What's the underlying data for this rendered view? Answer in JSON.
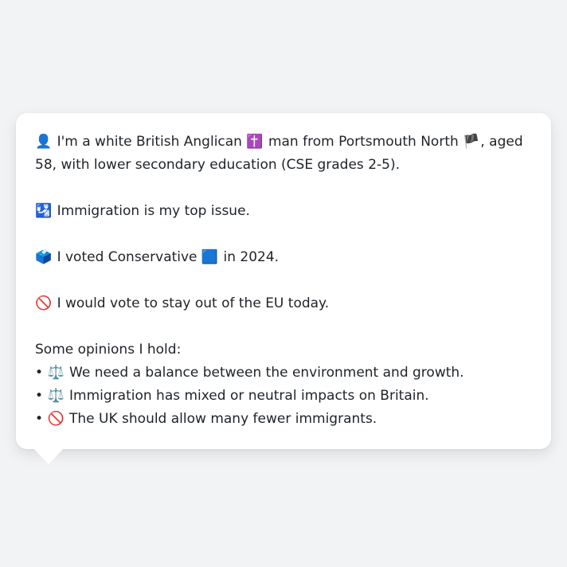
{
  "profile": {
    "identity": {
      "person_emoji": "👤",
      "text_before_religion": "I'm a white British Anglican",
      "religion_emoji": "✝️",
      "text_before_flag": "man from Portsmouth North",
      "flag_emoji": "🏴",
      "text_after_flag": ", aged 58, with lower secondary education (CSE grades 2-5)."
    },
    "top_issue": {
      "emoji": "🛂",
      "text": "Immigration is my top issue."
    },
    "vote": {
      "emoji": "🗳️",
      "text_before_party": "I voted Conservative",
      "party_emoji": "🟦",
      "text_after_party": "in 2024."
    },
    "eu": {
      "emoji": "🚫",
      "text": "I would vote to stay out of the EU today."
    },
    "opinions": {
      "heading": "Some opinions I hold:",
      "bullet": "•",
      "items": [
        {
          "emoji": "⚖️",
          "text": "We need a balance between the environment and growth."
        },
        {
          "emoji": "⚖️",
          "text": "Immigration has mixed or neutral impacts on Britain."
        },
        {
          "emoji": "🚫",
          "text": "The UK should allow many fewer immigrants."
        }
      ]
    }
  }
}
